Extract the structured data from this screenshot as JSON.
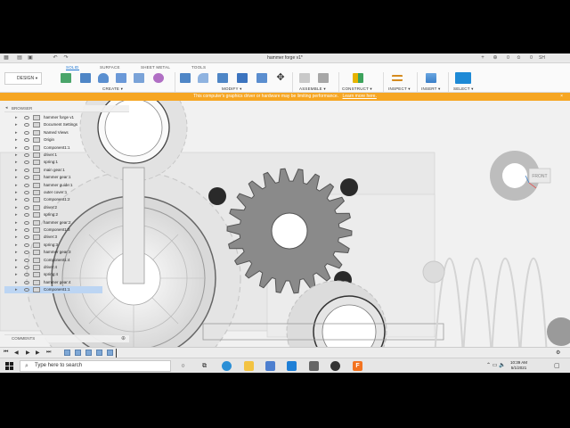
{
  "window": {
    "title": "hammer forge v1*"
  },
  "titlebar_right": [
    "0",
    "0",
    "SH"
  ],
  "ribbon": {
    "design_label": "DESIGN",
    "tabs": [
      "SOLID",
      "SURFACE",
      "SHEET METAL",
      "TOOLS"
    ],
    "groups": [
      "CREATE",
      "MODIFY",
      "ASSEMBLE",
      "CONSTRUCT",
      "INSPECT",
      "INSERT",
      "SELECT"
    ]
  },
  "warning": {
    "text": "This computer's graphics driver or hardware may be limiting performance.",
    "link": "Learn more here."
  },
  "browser": {
    "label": "BROWSER",
    "items": [
      {
        "label": "hammer forge v1"
      },
      {
        "label": "Document Settings"
      },
      {
        "label": "Named Views"
      },
      {
        "label": "Origin"
      },
      {
        "label": "Component1:1"
      },
      {
        "label": "driver:1"
      },
      {
        "label": "spring:1"
      },
      {
        "label": "main gear:1"
      },
      {
        "label": "hammer gear:1"
      },
      {
        "label": "hammer guide:1"
      },
      {
        "label": "outer cover:1"
      },
      {
        "label": "Component1:2"
      },
      {
        "label": "driver:2"
      },
      {
        "label": "spring:2"
      },
      {
        "label": "hammer gear:2"
      },
      {
        "label": "Component1:3"
      },
      {
        "label": "driver:3"
      },
      {
        "label": "spring:3"
      },
      {
        "label": "hammer gear:3"
      },
      {
        "label": "Component1:4"
      },
      {
        "label": "driver:4"
      },
      {
        "label": "spring:4"
      },
      {
        "label": "hammer gear:4"
      },
      {
        "label": "Component1:1"
      }
    ]
  },
  "viewcube_label": "FRONT",
  "comments_label": "COMMENTS",
  "taskbar": {
    "search_placeholder": "Type here to search",
    "time": "10:39 AM",
    "date": "5/1/2021"
  },
  "colors": {
    "warning": "#f6a623",
    "accent": "#1e77d3",
    "fusion_orange": "#f37320"
  }
}
